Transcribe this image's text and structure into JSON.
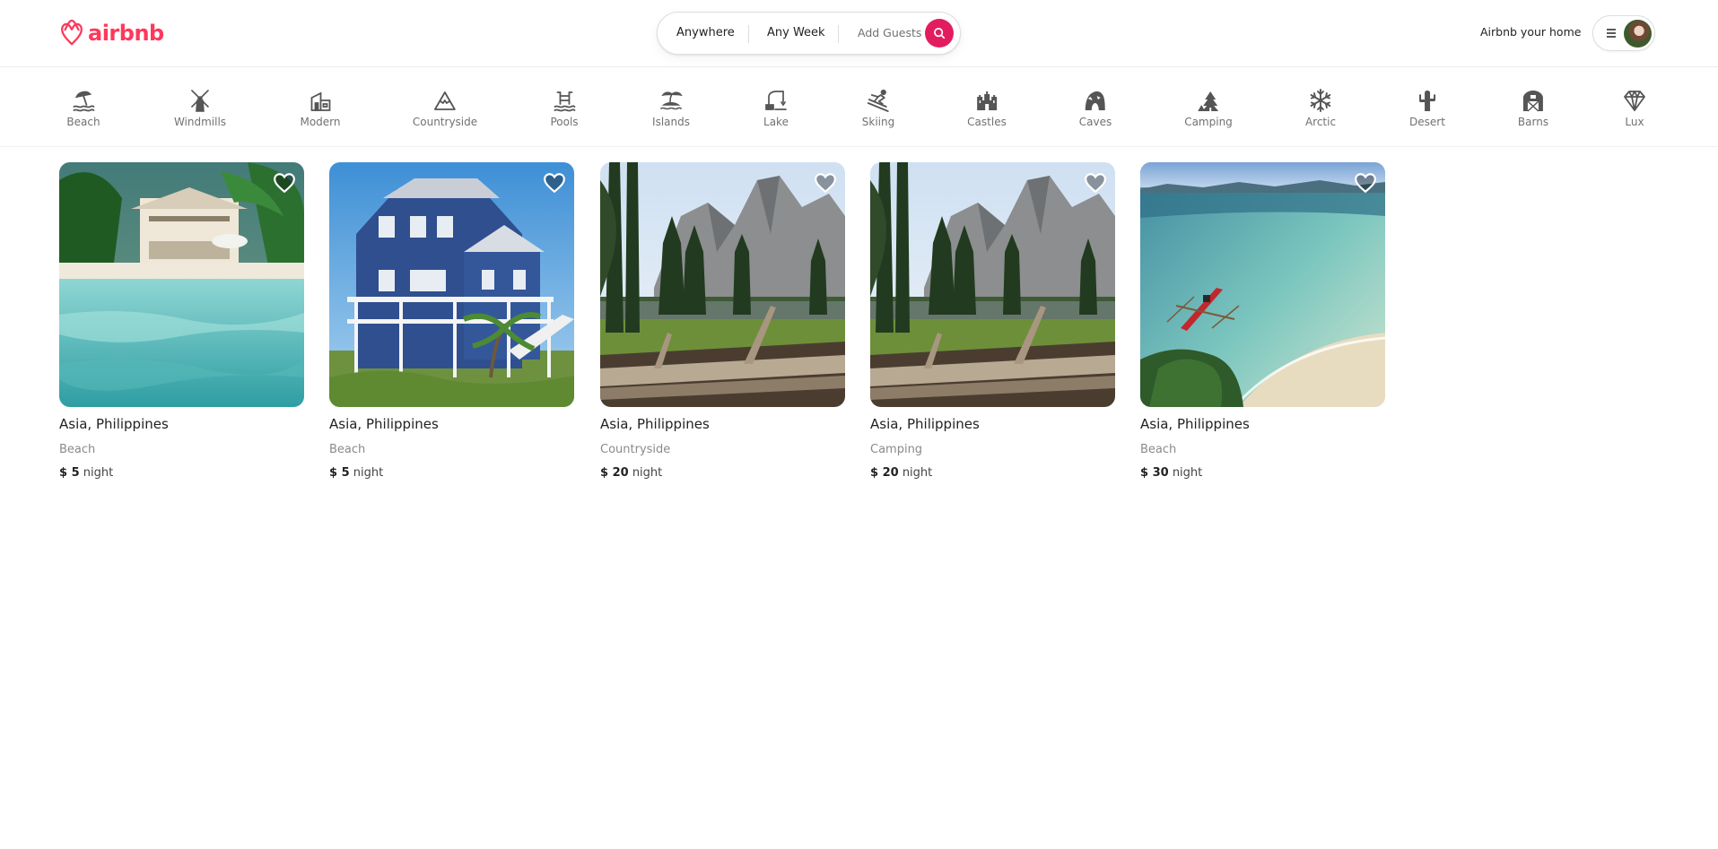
{
  "brand": {
    "name": "airbnb",
    "color": "#ff385c"
  },
  "search": {
    "where": "Anywhere",
    "when": "Any Week",
    "guests": "Add Guests",
    "button_color": "#e31c5f"
  },
  "header": {
    "host_link": "Airbnb your home"
  },
  "categories": [
    {
      "label": "Beach",
      "icon": "beach-icon"
    },
    {
      "label": "Windmills",
      "icon": "windmill-icon"
    },
    {
      "label": "Modern",
      "icon": "modern-house-icon"
    },
    {
      "label": "Countryside",
      "icon": "mountain-icon"
    },
    {
      "label": "Pools",
      "icon": "pool-icon"
    },
    {
      "label": "Islands",
      "icon": "island-icon"
    },
    {
      "label": "Lake",
      "icon": "lake-icon"
    },
    {
      "label": "Skiing",
      "icon": "skier-icon"
    },
    {
      "label": "Castles",
      "icon": "castle-icon"
    },
    {
      "label": "Caves",
      "icon": "cave-icon"
    },
    {
      "label": "Camping",
      "icon": "camping-icon"
    },
    {
      "label": "Arctic",
      "icon": "snowflake-icon"
    },
    {
      "label": "Desert",
      "icon": "cactus-icon"
    },
    {
      "label": "Barns",
      "icon": "barn-icon"
    },
    {
      "label": "Lux",
      "icon": "diamond-icon"
    }
  ],
  "listings": [
    {
      "location": "Asia, Philippines",
      "category": "Beach",
      "currency": "$",
      "price": "5",
      "unit": "night",
      "photo": "beach-villa"
    },
    {
      "location": "Asia, Philippines",
      "category": "Beach",
      "currency": "$",
      "price": "5",
      "unit": "night",
      "photo": "blue-house"
    },
    {
      "location": "Asia, Philippines",
      "category": "Countryside",
      "currency": "$",
      "price": "20",
      "unit": "night",
      "photo": "mountain-valley"
    },
    {
      "location": "Asia, Philippines",
      "category": "Camping",
      "currency": "$",
      "price": "20",
      "unit": "night",
      "photo": "mountain-valley"
    },
    {
      "location": "Asia, Philippines",
      "category": "Beach",
      "currency": "$",
      "price": "30",
      "unit": "night",
      "photo": "lagoon-boat"
    }
  ]
}
